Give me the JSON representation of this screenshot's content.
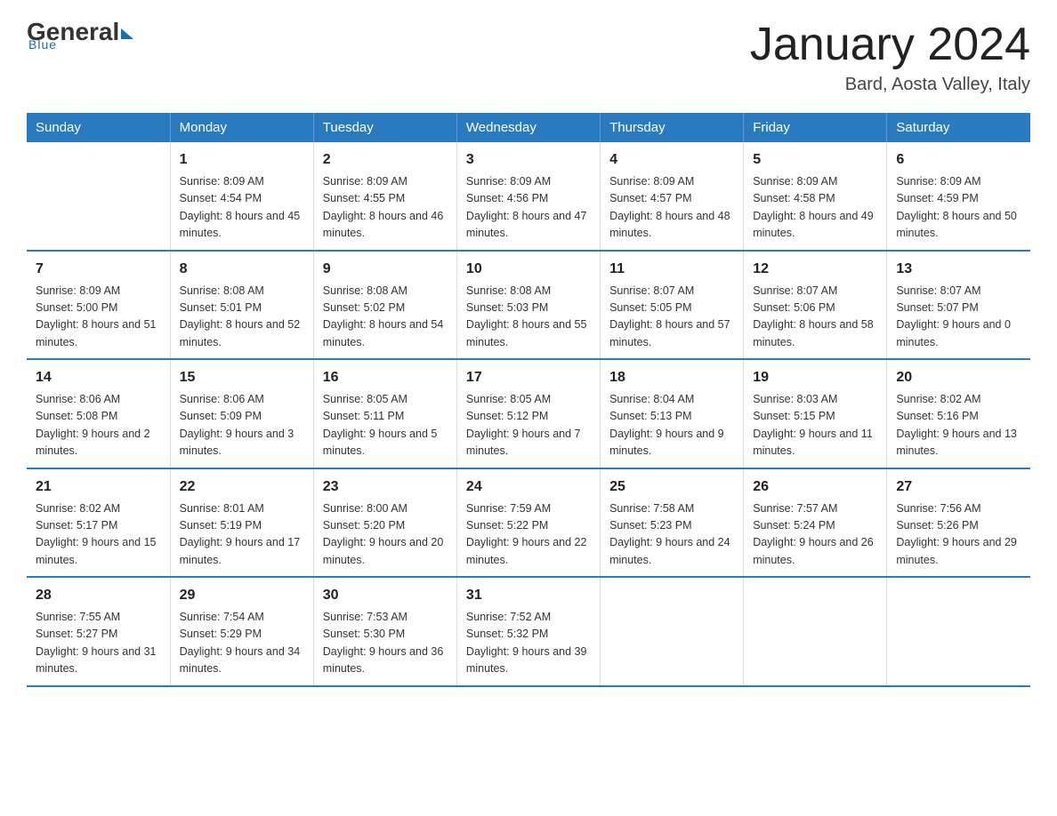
{
  "logo": {
    "general": "General",
    "blue": "Blue",
    "tagline": "Blue"
  },
  "header": {
    "month": "January 2024",
    "location": "Bard, Aosta Valley, Italy"
  },
  "days_of_week": [
    "Sunday",
    "Monday",
    "Tuesday",
    "Wednesday",
    "Thursday",
    "Friday",
    "Saturday"
  ],
  "weeks": [
    [
      {
        "day": "",
        "sunrise": "",
        "sunset": "",
        "daylight": ""
      },
      {
        "day": "1",
        "sunrise": "Sunrise: 8:09 AM",
        "sunset": "Sunset: 4:54 PM",
        "daylight": "Daylight: 8 hours and 45 minutes."
      },
      {
        "day": "2",
        "sunrise": "Sunrise: 8:09 AM",
        "sunset": "Sunset: 4:55 PM",
        "daylight": "Daylight: 8 hours and 46 minutes."
      },
      {
        "day": "3",
        "sunrise": "Sunrise: 8:09 AM",
        "sunset": "Sunset: 4:56 PM",
        "daylight": "Daylight: 8 hours and 47 minutes."
      },
      {
        "day": "4",
        "sunrise": "Sunrise: 8:09 AM",
        "sunset": "Sunset: 4:57 PM",
        "daylight": "Daylight: 8 hours and 48 minutes."
      },
      {
        "day": "5",
        "sunrise": "Sunrise: 8:09 AM",
        "sunset": "Sunset: 4:58 PM",
        "daylight": "Daylight: 8 hours and 49 minutes."
      },
      {
        "day": "6",
        "sunrise": "Sunrise: 8:09 AM",
        "sunset": "Sunset: 4:59 PM",
        "daylight": "Daylight: 8 hours and 50 minutes."
      }
    ],
    [
      {
        "day": "7",
        "sunrise": "Sunrise: 8:09 AM",
        "sunset": "Sunset: 5:00 PM",
        "daylight": "Daylight: 8 hours and 51 minutes."
      },
      {
        "day": "8",
        "sunrise": "Sunrise: 8:08 AM",
        "sunset": "Sunset: 5:01 PM",
        "daylight": "Daylight: 8 hours and 52 minutes."
      },
      {
        "day": "9",
        "sunrise": "Sunrise: 8:08 AM",
        "sunset": "Sunset: 5:02 PM",
        "daylight": "Daylight: 8 hours and 54 minutes."
      },
      {
        "day": "10",
        "sunrise": "Sunrise: 8:08 AM",
        "sunset": "Sunset: 5:03 PM",
        "daylight": "Daylight: 8 hours and 55 minutes."
      },
      {
        "day": "11",
        "sunrise": "Sunrise: 8:07 AM",
        "sunset": "Sunset: 5:05 PM",
        "daylight": "Daylight: 8 hours and 57 minutes."
      },
      {
        "day": "12",
        "sunrise": "Sunrise: 8:07 AM",
        "sunset": "Sunset: 5:06 PM",
        "daylight": "Daylight: 8 hours and 58 minutes."
      },
      {
        "day": "13",
        "sunrise": "Sunrise: 8:07 AM",
        "sunset": "Sunset: 5:07 PM",
        "daylight": "Daylight: 9 hours and 0 minutes."
      }
    ],
    [
      {
        "day": "14",
        "sunrise": "Sunrise: 8:06 AM",
        "sunset": "Sunset: 5:08 PM",
        "daylight": "Daylight: 9 hours and 2 minutes."
      },
      {
        "day": "15",
        "sunrise": "Sunrise: 8:06 AM",
        "sunset": "Sunset: 5:09 PM",
        "daylight": "Daylight: 9 hours and 3 minutes."
      },
      {
        "day": "16",
        "sunrise": "Sunrise: 8:05 AM",
        "sunset": "Sunset: 5:11 PM",
        "daylight": "Daylight: 9 hours and 5 minutes."
      },
      {
        "day": "17",
        "sunrise": "Sunrise: 8:05 AM",
        "sunset": "Sunset: 5:12 PM",
        "daylight": "Daylight: 9 hours and 7 minutes."
      },
      {
        "day": "18",
        "sunrise": "Sunrise: 8:04 AM",
        "sunset": "Sunset: 5:13 PM",
        "daylight": "Daylight: 9 hours and 9 minutes."
      },
      {
        "day": "19",
        "sunrise": "Sunrise: 8:03 AM",
        "sunset": "Sunset: 5:15 PM",
        "daylight": "Daylight: 9 hours and 11 minutes."
      },
      {
        "day": "20",
        "sunrise": "Sunrise: 8:02 AM",
        "sunset": "Sunset: 5:16 PM",
        "daylight": "Daylight: 9 hours and 13 minutes."
      }
    ],
    [
      {
        "day": "21",
        "sunrise": "Sunrise: 8:02 AM",
        "sunset": "Sunset: 5:17 PM",
        "daylight": "Daylight: 9 hours and 15 minutes."
      },
      {
        "day": "22",
        "sunrise": "Sunrise: 8:01 AM",
        "sunset": "Sunset: 5:19 PM",
        "daylight": "Daylight: 9 hours and 17 minutes."
      },
      {
        "day": "23",
        "sunrise": "Sunrise: 8:00 AM",
        "sunset": "Sunset: 5:20 PM",
        "daylight": "Daylight: 9 hours and 20 minutes."
      },
      {
        "day": "24",
        "sunrise": "Sunrise: 7:59 AM",
        "sunset": "Sunset: 5:22 PM",
        "daylight": "Daylight: 9 hours and 22 minutes."
      },
      {
        "day": "25",
        "sunrise": "Sunrise: 7:58 AM",
        "sunset": "Sunset: 5:23 PM",
        "daylight": "Daylight: 9 hours and 24 minutes."
      },
      {
        "day": "26",
        "sunrise": "Sunrise: 7:57 AM",
        "sunset": "Sunset: 5:24 PM",
        "daylight": "Daylight: 9 hours and 26 minutes."
      },
      {
        "day": "27",
        "sunrise": "Sunrise: 7:56 AM",
        "sunset": "Sunset: 5:26 PM",
        "daylight": "Daylight: 9 hours and 29 minutes."
      }
    ],
    [
      {
        "day": "28",
        "sunrise": "Sunrise: 7:55 AM",
        "sunset": "Sunset: 5:27 PM",
        "daylight": "Daylight: 9 hours and 31 minutes."
      },
      {
        "day": "29",
        "sunrise": "Sunrise: 7:54 AM",
        "sunset": "Sunset: 5:29 PM",
        "daylight": "Daylight: 9 hours and 34 minutes."
      },
      {
        "day": "30",
        "sunrise": "Sunrise: 7:53 AM",
        "sunset": "Sunset: 5:30 PM",
        "daylight": "Daylight: 9 hours and 36 minutes."
      },
      {
        "day": "31",
        "sunrise": "Sunrise: 7:52 AM",
        "sunset": "Sunset: 5:32 PM",
        "daylight": "Daylight: 9 hours and 39 minutes."
      },
      {
        "day": "",
        "sunrise": "",
        "sunset": "",
        "daylight": ""
      },
      {
        "day": "",
        "sunrise": "",
        "sunset": "",
        "daylight": ""
      },
      {
        "day": "",
        "sunrise": "",
        "sunset": "",
        "daylight": ""
      }
    ]
  ]
}
